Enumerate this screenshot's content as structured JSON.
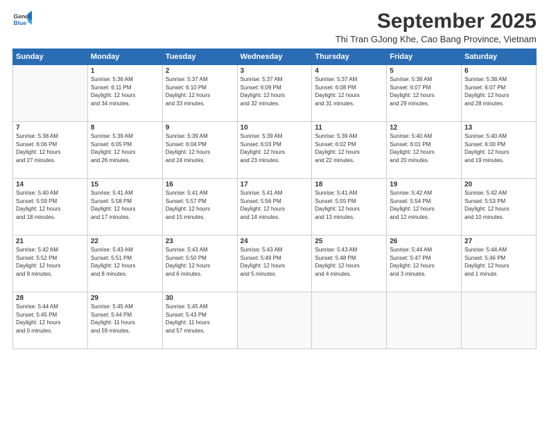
{
  "logo": {
    "line1": "General",
    "line2": "Blue"
  },
  "title": "September 2025",
  "subtitle": "Thi Tran GJong Khe, Cao Bang Province, Vietnam",
  "days_of_week": [
    "Sunday",
    "Monday",
    "Tuesday",
    "Wednesday",
    "Thursday",
    "Friday",
    "Saturday"
  ],
  "weeks": [
    [
      {
        "num": "",
        "info": ""
      },
      {
        "num": "1",
        "info": "Sunrise: 5:36 AM\nSunset: 6:11 PM\nDaylight: 12 hours\nand 34 minutes."
      },
      {
        "num": "2",
        "info": "Sunrise: 5:37 AM\nSunset: 6:10 PM\nDaylight: 12 hours\nand 33 minutes."
      },
      {
        "num": "3",
        "info": "Sunrise: 5:37 AM\nSunset: 6:09 PM\nDaylight: 12 hours\nand 32 minutes."
      },
      {
        "num": "4",
        "info": "Sunrise: 5:37 AM\nSunset: 6:08 PM\nDaylight: 12 hours\nand 31 minutes."
      },
      {
        "num": "5",
        "info": "Sunrise: 5:38 AM\nSunset: 6:07 PM\nDaylight: 12 hours\nand 29 minutes."
      },
      {
        "num": "6",
        "info": "Sunrise: 5:38 AM\nSunset: 6:07 PM\nDaylight: 12 hours\nand 28 minutes."
      }
    ],
    [
      {
        "num": "7",
        "info": "Sunrise: 5:38 AM\nSunset: 6:06 PM\nDaylight: 12 hours\nand 27 minutes."
      },
      {
        "num": "8",
        "info": "Sunrise: 5:39 AM\nSunset: 6:05 PM\nDaylight: 12 hours\nand 26 minutes."
      },
      {
        "num": "9",
        "info": "Sunrise: 5:39 AM\nSunset: 6:04 PM\nDaylight: 12 hours\nand 24 minutes."
      },
      {
        "num": "10",
        "info": "Sunrise: 5:39 AM\nSunset: 6:03 PM\nDaylight: 12 hours\nand 23 minutes."
      },
      {
        "num": "11",
        "info": "Sunrise: 5:39 AM\nSunset: 6:02 PM\nDaylight: 12 hours\nand 22 minutes."
      },
      {
        "num": "12",
        "info": "Sunrise: 5:40 AM\nSunset: 6:01 PM\nDaylight: 12 hours\nand 20 minutes."
      },
      {
        "num": "13",
        "info": "Sunrise: 5:40 AM\nSunset: 6:00 PM\nDaylight: 12 hours\nand 19 minutes."
      }
    ],
    [
      {
        "num": "14",
        "info": "Sunrise: 5:40 AM\nSunset: 5:59 PM\nDaylight: 12 hours\nand 18 minutes."
      },
      {
        "num": "15",
        "info": "Sunrise: 5:41 AM\nSunset: 5:58 PM\nDaylight: 12 hours\nand 17 minutes."
      },
      {
        "num": "16",
        "info": "Sunrise: 5:41 AM\nSunset: 5:57 PM\nDaylight: 12 hours\nand 15 minutes."
      },
      {
        "num": "17",
        "info": "Sunrise: 5:41 AM\nSunset: 5:56 PM\nDaylight: 12 hours\nand 14 minutes."
      },
      {
        "num": "18",
        "info": "Sunrise: 5:41 AM\nSunset: 5:55 PM\nDaylight: 12 hours\nand 13 minutes."
      },
      {
        "num": "19",
        "info": "Sunrise: 5:42 AM\nSunset: 5:54 PM\nDaylight: 12 hours\nand 12 minutes."
      },
      {
        "num": "20",
        "info": "Sunrise: 5:42 AM\nSunset: 5:53 PM\nDaylight: 12 hours\nand 10 minutes."
      }
    ],
    [
      {
        "num": "21",
        "info": "Sunrise: 5:42 AM\nSunset: 5:52 PM\nDaylight: 12 hours\nand 9 minutes."
      },
      {
        "num": "22",
        "info": "Sunrise: 5:43 AM\nSunset: 5:51 PM\nDaylight: 12 hours\nand 8 minutes."
      },
      {
        "num": "23",
        "info": "Sunrise: 5:43 AM\nSunset: 5:50 PM\nDaylight: 12 hours\nand 6 minutes."
      },
      {
        "num": "24",
        "info": "Sunrise: 5:43 AM\nSunset: 5:49 PM\nDaylight: 12 hours\nand 5 minutes."
      },
      {
        "num": "25",
        "info": "Sunrise: 5:43 AM\nSunset: 5:48 PM\nDaylight: 12 hours\nand 4 minutes."
      },
      {
        "num": "26",
        "info": "Sunrise: 5:44 AM\nSunset: 5:47 PM\nDaylight: 12 hours\nand 3 minutes."
      },
      {
        "num": "27",
        "info": "Sunrise: 5:44 AM\nSunset: 5:46 PM\nDaylight: 12 hours\nand 1 minute."
      }
    ],
    [
      {
        "num": "28",
        "info": "Sunrise: 5:44 AM\nSunset: 5:45 PM\nDaylight: 12 hours\nand 0 minutes."
      },
      {
        "num": "29",
        "info": "Sunrise: 5:45 AM\nSunset: 5:44 PM\nDaylight: 11 hours\nand 59 minutes."
      },
      {
        "num": "30",
        "info": "Sunrise: 5:45 AM\nSunset: 5:43 PM\nDaylight: 11 hours\nand 57 minutes."
      },
      {
        "num": "",
        "info": ""
      },
      {
        "num": "",
        "info": ""
      },
      {
        "num": "",
        "info": ""
      },
      {
        "num": "",
        "info": ""
      }
    ]
  ]
}
